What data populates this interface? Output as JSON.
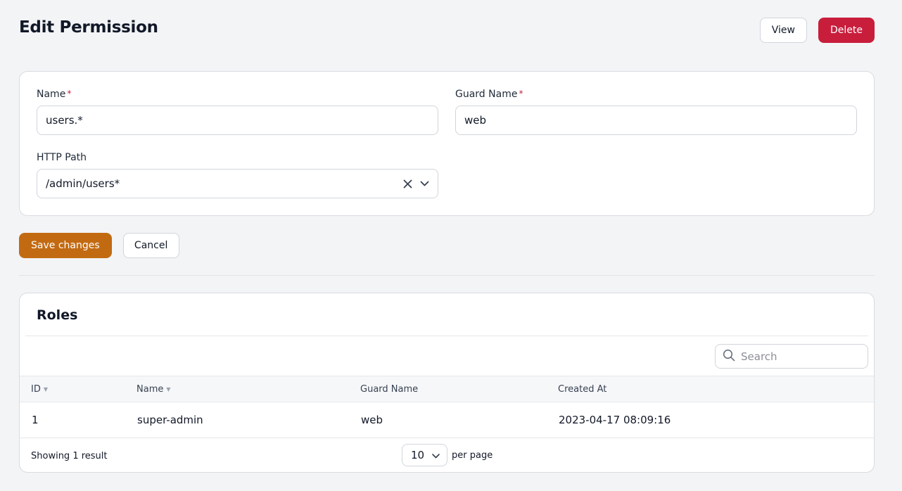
{
  "header": {
    "title": "Edit Permission",
    "view_label": "View",
    "delete_label": "Delete"
  },
  "form": {
    "name_label": "Name",
    "name_value": "users.*",
    "guard_label": "Guard Name",
    "guard_value": "web",
    "required_mark": "*",
    "http_path_label": "HTTP Path",
    "http_path_value": "/admin/users*",
    "save_label": "Save changes",
    "cancel_label": "Cancel"
  },
  "roles": {
    "title": "Roles",
    "search_placeholder": "Search",
    "columns": [
      "ID",
      "Name",
      "Guard Name",
      "Created At"
    ],
    "rows": [
      {
        "id": "1",
        "name": "super-admin",
        "guard": "web",
        "created_at": "2023-04-17 08:09:16"
      }
    ],
    "footer": {
      "showing": "Showing 1 result",
      "per_page_value": "10",
      "per_page_label": "per page"
    }
  },
  "colors": {
    "primary": "#c26a12",
    "danger": "#c81e3c",
    "background": "#f3f4f6"
  }
}
